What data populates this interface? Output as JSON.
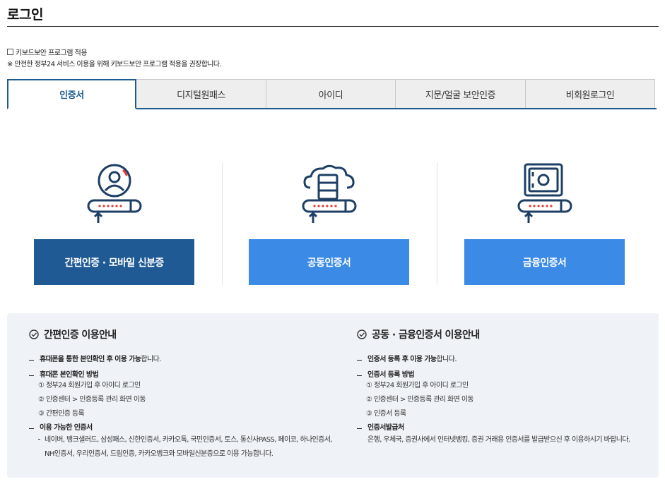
{
  "page": {
    "title": "로그인"
  },
  "keyboard": {
    "checkbox_label": "키보드보안 프로그램 적용",
    "note": "※ 안전한 정부24 서비스 이용을 위해 키보드보안 프로그램 적용을 권장합니다."
  },
  "tabs": [
    {
      "label": "인증서",
      "active": true
    },
    {
      "label": "디지털원패스"
    },
    {
      "label": "아이디"
    },
    {
      "label": "지문/얼굴 보안인증"
    },
    {
      "label": "비회원로그인"
    }
  ],
  "cert_options": [
    {
      "label": "간편인증 · 모바일 신분증",
      "icon": "person-login-icon",
      "color": "#1f5a94"
    },
    {
      "label": "공동인증서",
      "icon": "cloud-server-login-icon",
      "color": "#3a8ae6"
    },
    {
      "label": "금융인증서",
      "icon": "safe-login-icon",
      "color": "#3a8ae6"
    }
  ],
  "guide_simple": {
    "title": "간편인증 이용안내",
    "item1_bold": "휴대폰을 통한 본인확인 후 이용 가능",
    "item1_rest": "합니다.",
    "item2": "휴대폰 본인확인 방법",
    "steps": [
      "① 정부24 회원가입 후 아이디 로그인",
      "② 인증센터 > 인증등록 관리 화면 이동",
      "③ 간편인증 등록"
    ],
    "item3": "이용 가능한 인증서",
    "providers": "네이버, 뱅크샐러드, 삼성패스, 신한인증서, 카카오톡, 국민인증서, 토스, 통신사PASS, 페이코, 하나인증서, NH인증서, 우리인증서, 드림인증, 카카오뱅크와 모바일신분증으로 이용 가능합니다."
  },
  "guide_joint": {
    "title": "공동 · 금융인증서 이용안내",
    "item1_bold": "인증서 등록 후 이용 가능",
    "item1_rest": "합니다.",
    "item2": "인증서 등록 방법",
    "steps": [
      "① 정부24 회원가입 후 아이디 로그인",
      "② 인증센터 > 인증등록 관리 화면 이동",
      "③ 인증서 등록"
    ],
    "item3": "인증서발급처",
    "issuers": "은행, 우체국, 증권사에서 인터넷뱅킹, 증권 거래용 인증서를 발급받으신 후 이용하시기 바랍니다."
  }
}
